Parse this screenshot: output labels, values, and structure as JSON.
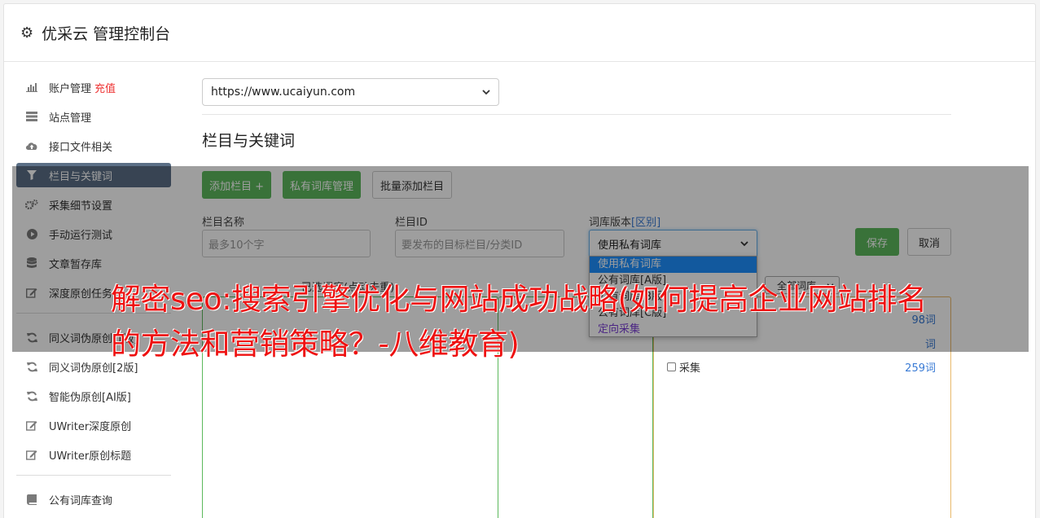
{
  "app": {
    "title": "优采云 管理控制台",
    "icon": "gear-icon"
  },
  "sidebar": {
    "items": [
      {
        "label": "账户管理",
        "extra": "充值",
        "icon": "bar-chart-icon"
      },
      {
        "label": "站点管理",
        "icon": "server-icon"
      },
      {
        "label": "接口文件相关",
        "icon": "cloud-upload-icon"
      },
      {
        "label": "栏目与关键词",
        "icon": "filter-icon",
        "active": true
      },
      {
        "label": "采集细节设置",
        "icon": "cogs-icon"
      },
      {
        "label": "手动运行测试",
        "icon": "play-circle-icon"
      },
      {
        "label": "文章暂存库",
        "icon": "database-icon"
      },
      {
        "label": "深度原创任务",
        "icon": "edit-icon"
      },
      {
        "label": "同义词伪原创[1版]",
        "icon": "refresh-icon"
      },
      {
        "label": "同义词伪原创[2版]",
        "icon": "refresh-icon"
      },
      {
        "label": "智能伪原创[AI版]",
        "icon": "refresh-icon"
      },
      {
        "label": "UWriter深度原创",
        "icon": "edit-icon"
      },
      {
        "label": "UWriter原创标题",
        "icon": "edit-icon"
      },
      {
        "label": "公有词库查询",
        "icon": "book-icon"
      }
    ]
  },
  "main": {
    "site_select": "https://www.ucaiyun.com",
    "section_title": "栏目与关键词",
    "buttons": {
      "add_column": "添加栏目 +",
      "private_lib": "私有词库管理",
      "batch_add": "批量添加栏目"
    },
    "form": {
      "name_label": "栏目名称",
      "name_placeholder": "最多10个字",
      "id_label": "栏目ID",
      "id_placeholder": "要发布的目标栏目/分类ID",
      "version_label": "词库版本",
      "version_diff": "[区别]",
      "version_value": "使用私有词库",
      "save": "保存",
      "cancel": "取消"
    },
    "dropdown_options": [
      "使用私有词库",
      "公有词库[A版]",
      "公有词库[B版]",
      "公有词库[C版]",
      "定向采集"
    ],
    "selected_caption": "已选词库(点动去重)",
    "lib_filter": "全部词库",
    "keyword_rows": [
      {
        "name": "",
        "count": "98词"
      },
      {
        "name": "",
        "count": "词"
      },
      {
        "name": "采集",
        "count": "259词"
      }
    ]
  },
  "overlay": {
    "watermark": "解密seo:搜索引擎优化与网站成功战略(如何提高企业网站排名的方法和营销策略？-八维教育)"
  }
}
